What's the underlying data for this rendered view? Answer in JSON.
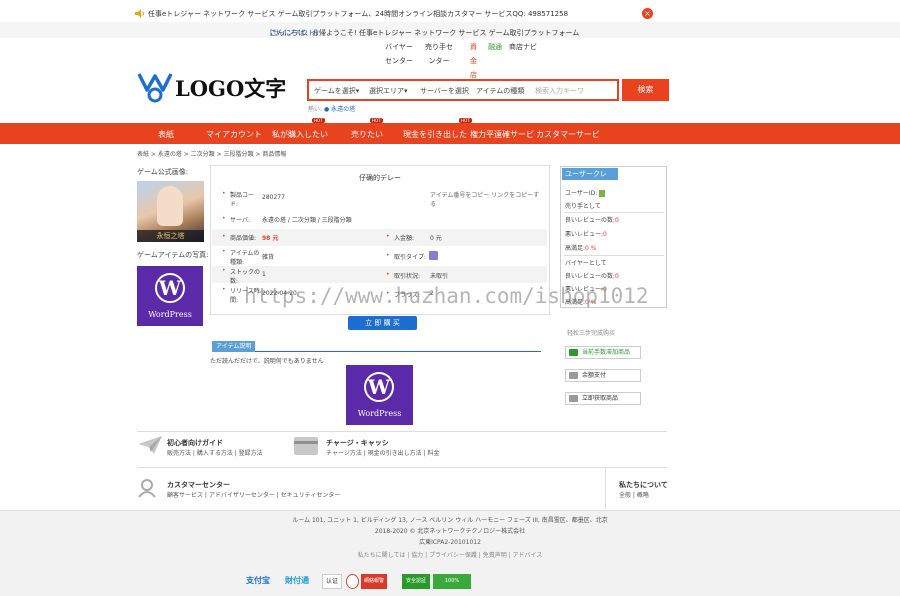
{
  "topbar": {
    "notice": "任事eトレジャー ネットワーク サービス ゲーム取引プラットフォーム、24時間オンライン相談カスタマー サービスQQ: 498571258",
    "close_icon": "close-icon"
  },
  "greet": {
    "text": "こんにちは、お帰ようこそ! 任事eトレジャー ネットワーク サービス ゲーム取引プラットフォーム",
    "login_link": "[サインアウト]"
  },
  "mini_nav": [
    {
      "label": "バイヤーセンター"
    },
    {
      "label": "売り手センター"
    },
    {
      "label": "資金店"
    },
    {
      "label": "融通"
    },
    {
      "label": "商店ナビ"
    }
  ],
  "logo": {
    "text": "LOGO文字"
  },
  "search": {
    "game_select": "ゲームを選択▾",
    "area_select": "選択エリア▾",
    "server_select": "サーバーを選択",
    "item_type": "アイテムの種類",
    "placeholder": "検索入力キーワ",
    "button": "検索"
  },
  "hot_words": {
    "label": "熱い:",
    "word": "永遠の塔"
  },
  "main_nav": {
    "items": [
      "表紙",
      "マイアカウント",
      "私が購入したい",
      "売りたい",
      "現金を引き出した",
      "権力平遠確サービ",
      "カスタマーサービ"
    ],
    "hot_tag": "HOT"
  },
  "breadcrumb": "表紙 > 永遠の塔 > 二次分類 > 三段階分類 > 商品情報",
  "left": {
    "game_official": "ゲーム公式画像:",
    "game_caption": "永恒之塔",
    "item_image_label": "ゲームアイテムの写真:",
    "wp_text": "WordPress"
  },
  "detail": {
    "title": "仔确的デレー",
    "product_code_label": "製品コード:",
    "product_code": "280277",
    "product_code_note": "アイテム番号をコピー リンクをコピーする",
    "server_label": "サーバ:",
    "server_value": "永遠の塔 / 二次分類 / 三段階分類",
    "price_label": "商品価値:",
    "price_value": "98 元",
    "deposit_label": "入金額:",
    "deposit_value": "0 元",
    "item_type_label": "アイテムの種類:",
    "item_type_value": "雑貨",
    "trade_type_label": "取引タイプ:",
    "stock_label": "ストックの数:",
    "stock_value": "1",
    "trade_status_label": "取引状況:",
    "trade_status_value": "未取引",
    "release_label": "リリース時間:",
    "release_value": "2022-04-20",
    "browse_label": "ブラウズ:",
    "browse_value": "2",
    "buy_button": "立 即 購 买"
  },
  "item_tab": {
    "label": "アイテム説明",
    "desc": "ただ読んだだけで、説明何でもありません"
  },
  "user_panel": {
    "header": "ユーザークレ",
    "user_id_label": "ユーザーID:",
    "seller_label": "売り手として",
    "good_seller": "良いレビューの数:",
    "good_seller_n": "0",
    "bad_seller": "悪いレビュー:",
    "bad_seller_n": "0",
    "rate_seller": "高満足:",
    "rate_seller_n": "0 %",
    "buyer_label": "バイヤーとして",
    "good_buyer": "良いレビューの数:",
    "good_buyer_n": "0",
    "bad_buyer": "悪いレビュー:",
    "bad_buyer_n": "0",
    "rate_buyer": "高満足:",
    "rate_buyer_n": "0 %"
  },
  "watermark": "https://www.huzhan.com/ishop1012",
  "steps": {
    "title": "轻松三步完成购买",
    "step1": "当前手数滞加商品",
    "step2": "余额支付",
    "step3": "立即获取商品"
  },
  "guides": {
    "novice_title": "初心者向けガイド",
    "novice_links": "販売方法 | 購入する方法 | 登録方法",
    "charge_title": "チャージ・キャッシ",
    "charge_links": "チャージ方法 | 現金の引き出し方法 | 料金",
    "cs_title": "カスタマーセンター",
    "cs_links": "顧客サービス | アドバイザリーセンター | セキュリティセンター",
    "about_title": "私たちについて",
    "about_links": "全般 | 概略"
  },
  "footer": {
    "address": "ルーム 101, ユニット 1, ビルディング 13, ノース ベルリン ウィル ハーモニー フェーズ III, 南昌霊区、都墨区、北京",
    "copyright": "2018-2020 © 北京ネットワークテクノロジー株式会社",
    "license": "広東ICPA2-20101012",
    "links": "私たちに関しては | 協力 | プライバシー保護 | 免責声明 | アドバイス",
    "badges": [
      "支付宝",
      "財付通",
      "认证",
      "",
      "網絡報警",
      "安全認証",
      "100%"
    ]
  }
}
